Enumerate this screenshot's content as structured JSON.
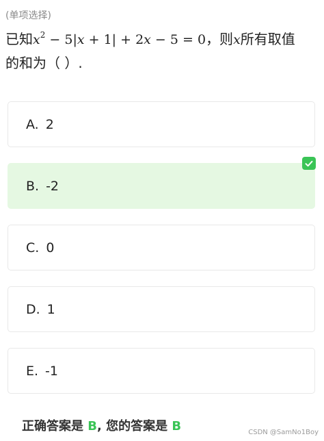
{
  "question": {
    "type_label": "(单项选择)",
    "prefix": "已知",
    "formula_parts": [
      "x",
      "2",
      " − 5|",
      "x",
      " + 1| + 2",
      "x",
      " − 5 = 0"
    ],
    "mid": "，则",
    "var": "x",
    "suffix_line1": "所有取值",
    "suffix_line2": "的和为（  ）."
  },
  "options": [
    {
      "letter": "A.",
      "value": "2",
      "selected": false
    },
    {
      "letter": "B.",
      "value": "-2",
      "selected": true
    },
    {
      "letter": "C.",
      "value": "0",
      "selected": false
    },
    {
      "letter": "D.",
      "value": "1",
      "selected": false
    },
    {
      "letter": "E.",
      "value": "-1",
      "selected": false
    }
  ],
  "result": {
    "correct_prefix": "正确答案是",
    "correct_answer": "B",
    "separator": ", ",
    "user_prefix": "您的答案是",
    "user_answer": "B"
  },
  "watermark": "CSDN @SamNo1Boy",
  "colors": {
    "accent_green": "#3ac456",
    "selected_bg": "#e5f8e2"
  }
}
